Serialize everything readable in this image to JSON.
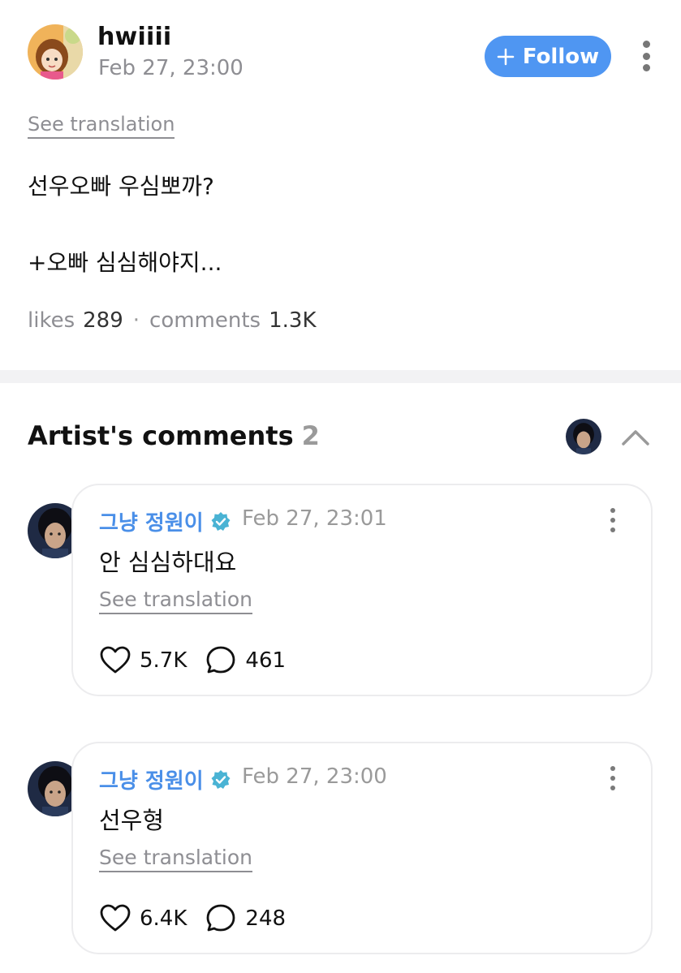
{
  "post": {
    "author": "hwiiii",
    "timestamp": "Feb 27, 23:00",
    "follow_label": "Follow",
    "see_translation": "See translation",
    "lines": [
      "선우오빠 우심뽀까?",
      "+오빠 심심해야지..."
    ],
    "likes_label": "likes",
    "likes_count": "289",
    "separator": "·",
    "comments_label": "comments",
    "comments_count": "1.3K",
    "icons": [
      "avatar-user",
      "plus-icon",
      "more-vertical-icon"
    ]
  },
  "artist_comments": {
    "title": "Artist's comments",
    "count": "2",
    "icons": [
      "artist-avatar",
      "chevron-up-icon"
    ],
    "items": [
      {
        "name": "그냥 정원이",
        "timestamp": "Feb 27, 23:01",
        "text": "안 심심하대요",
        "see_translation": "See translation",
        "likes": "5.7K",
        "replies": "461"
      },
      {
        "name": "그냥 정원이",
        "timestamp": "Feb 27, 23:00",
        "text": "선우형",
        "see_translation": "See translation",
        "likes": "6.4K",
        "replies": "248"
      }
    ]
  },
  "colors": {
    "follow_button": "#4f96f2",
    "artist_name": "#4a8fe8",
    "verified_badge": "#4ab3d4",
    "muted_text": "#8e8e93",
    "divider": "#f2f2f4"
  }
}
